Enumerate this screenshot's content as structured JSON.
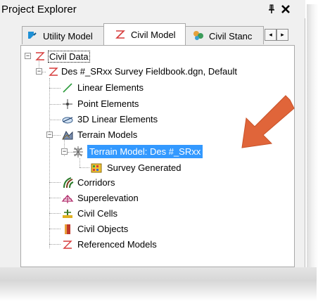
{
  "panel": {
    "title": "Project Explorer",
    "pin_glyph": "⊥",
    "close_glyph": "✕"
  },
  "tabs": [
    {
      "label": "Utility Model",
      "icon": "utility-model-icon",
      "active": false
    },
    {
      "label": "Civil Model",
      "icon": "civil-model-icon",
      "active": true
    },
    {
      "label": "Civil Stanc",
      "icon": "civil-standards-icon",
      "active": false
    }
  ],
  "tab_scroll": {
    "left": "◂",
    "right": "▸"
  },
  "tree": {
    "root": {
      "label": "Civil Data",
      "icon": "civil-data-icon",
      "expanded": true
    },
    "file": {
      "label": "Des #_SRxx Survey Fieldbook.dgn, Default",
      "icon": "dgn-file-icon",
      "expanded": true
    },
    "items": {
      "linear": "Linear Elements",
      "point": "Point Elements",
      "linear3d": "3D Linear Elements",
      "terrain": "Terrain Models",
      "terrain_model": "Terrain Model: Des #_SRxx",
      "survey_generated": "Survey Generated",
      "corridors": "Corridors",
      "superelevation": "Superelevation",
      "civil_cells": "Civil Cells",
      "civil_objects": "Civil Objects",
      "referenced_models": "Referenced Models"
    }
  },
  "colors": {
    "selection": "#3399ff",
    "annotation_arrow": "#e0653a"
  }
}
